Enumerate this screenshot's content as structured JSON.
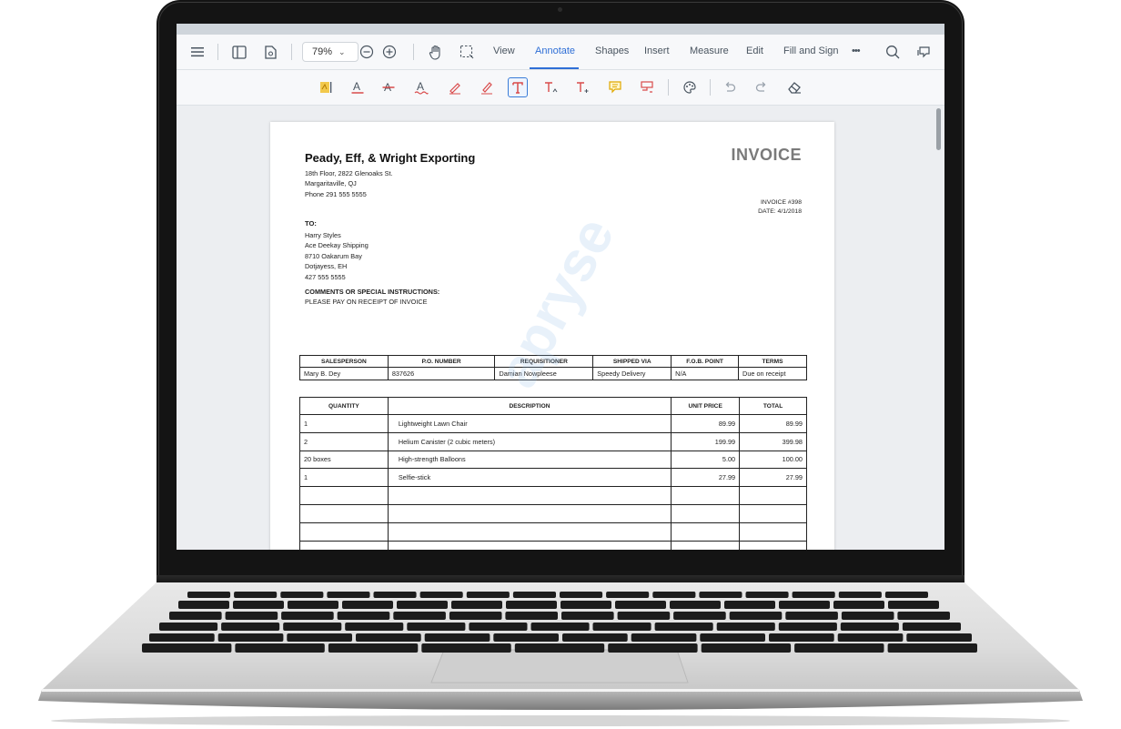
{
  "toolbar": {
    "zoom_value": "79%",
    "tabs": [
      "View",
      "Annotate",
      "Shapes",
      "Insert",
      "Measure",
      "Edit",
      "Fill and Sign"
    ],
    "active_tab": "Annotate",
    "more_label": "•••",
    "accent_color": "#2f6fd6"
  },
  "document": {
    "company": "Peady, Eff, & Wright Exporting",
    "address_lines": [
      "18th Floor, 2822 Glenoaks St.",
      "Margaritaville, QJ",
      "Phone 291 555 5555"
    ],
    "invoice_heading": "INVOICE",
    "invoice_number": "INVOICE #398",
    "invoice_date": "DATE: 4/1/2018",
    "to_label": "TO:",
    "to_lines": [
      "Harry Styles",
      "Ace Deekay Shipping",
      "8710 Oakarum Bay",
      "Dotjayess, EH",
      "427 555 5555"
    ],
    "comments_label": "COMMENTS OR SPECIAL INSTRUCTIONS:",
    "comments_text": "PLEASE PAY ON RECEIPT OF INVOICE",
    "watermark": "apryse",
    "order_headers": [
      "SALESPERSON",
      "P.O. NUMBER",
      "REQUISITIONER",
      "SHIPPED VIA",
      "F.O.B. POINT",
      "TERMS"
    ],
    "order_row": [
      "Mary B. Dey",
      "837626",
      "Damian Nowpleese",
      "Speedy Delivery",
      "N/A",
      "Due on receipt"
    ],
    "item_headers": [
      "QUANTITY",
      "DESCRIPTION",
      "UNIT PRICE",
      "TOTAL"
    ],
    "items": [
      [
        "1",
        "Lightweight Lawn Chair",
        "89.99",
        "89.99"
      ],
      [
        "2",
        "Helium Canister (2 cubic meters)",
        "199.99",
        "399.98"
      ],
      [
        "20 boxes",
        "High-strength Balloons",
        "5.00",
        "100.00"
      ],
      [
        "1",
        "Selfie-stick",
        "27.99",
        "27.99"
      ],
      [
        "",
        "",
        "",
        ""
      ],
      [
        "",
        "",
        "",
        ""
      ],
      [
        "",
        "",
        "",
        ""
      ],
      [
        "",
        "",
        "",
        ""
      ]
    ]
  }
}
